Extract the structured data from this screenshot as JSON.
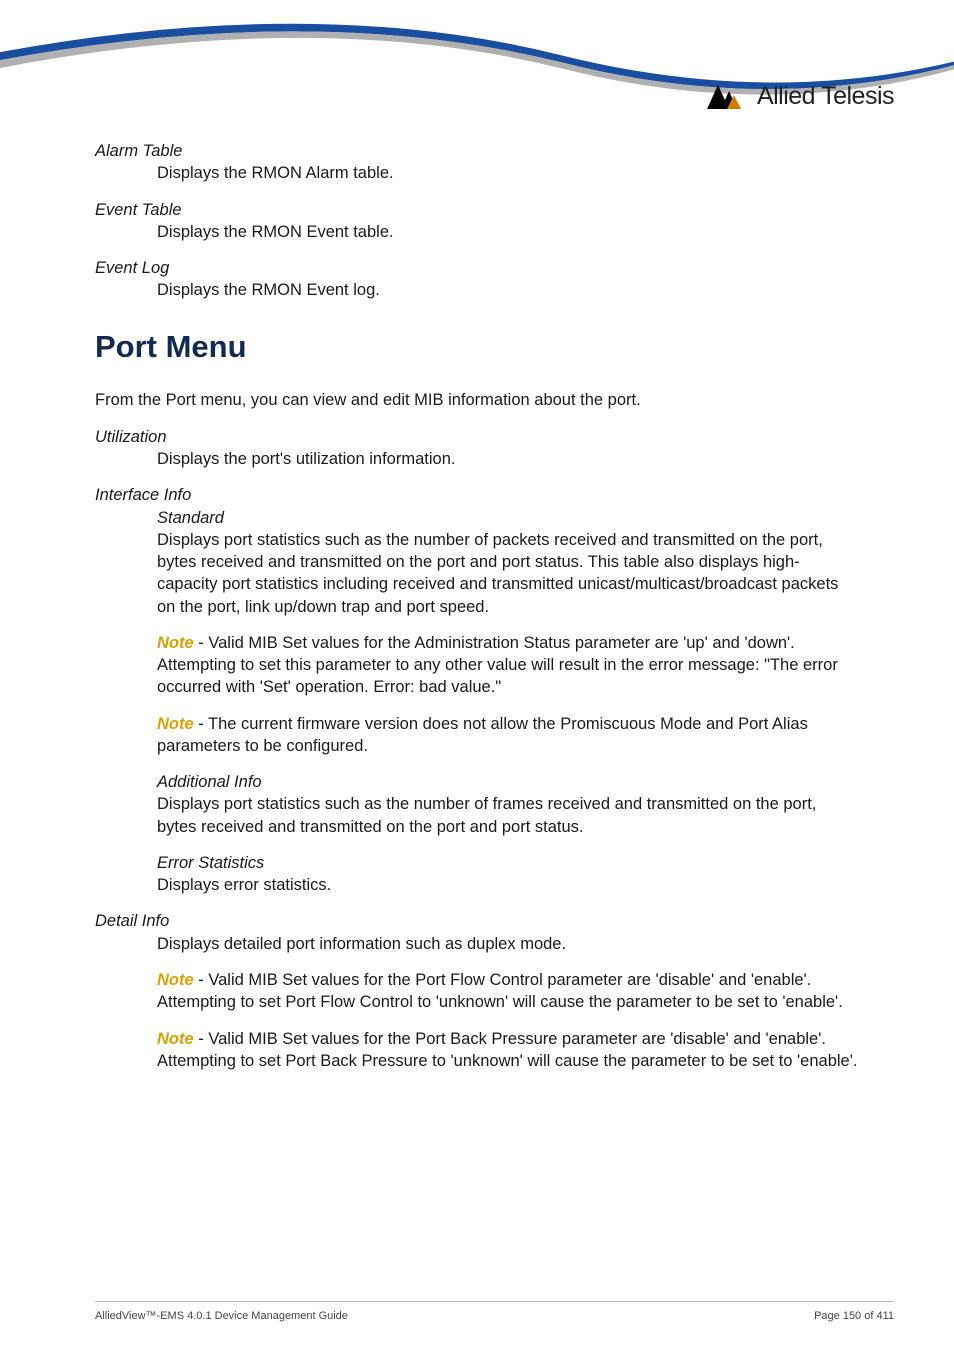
{
  "brand": "Allied Telesis",
  "sections": {
    "alarmTable": {
      "title": "Alarm Table",
      "body": "Displays the RMON Alarm table."
    },
    "eventTable": {
      "title": "Event Table",
      "body": "Displays the RMON Event table."
    },
    "eventLog": {
      "title": "Event Log",
      "body": "Displays the RMON Event log."
    }
  },
  "headingPortMenu": "Port Menu",
  "portMenuIntro": "From the Port menu, you can view and edit MIB information about the port.",
  "utilization": {
    "title": "Utilization",
    "body": "Displays the port's utilization information."
  },
  "interfaceInfo": {
    "title": "Interface Info",
    "standard": {
      "title": "Standard",
      "body": "Displays port statistics such as the number of packets received and transmitted on the port, bytes received and transmitted on the port and port status. This table also displays high-capacity port statistics including received and transmitted unicast/multicast/broadcast packets on the port, link up/down trap and port speed.",
      "note1Label": "Note",
      "note1Body": " - Valid MIB Set values for the Administration Status parameter are 'up' and 'down'. Attempting to set this parameter to any other value will result in the error message: \"The error occurred with 'Set' operation. Error: bad value.\"",
      "note2Label": "Note",
      "note2Body": " - The current firmware version does not allow the Promiscuous Mode and Port Alias parameters to be configured."
    },
    "additional": {
      "title": "Additional Info",
      "body": "Displays port statistics such as the number of frames received and transmitted on the port, bytes received and transmitted on the port and port status."
    },
    "error": {
      "title": "Error Statistics",
      "body": "Displays error statistics."
    }
  },
  "detailInfo": {
    "title": "Detail Info",
    "body": "Displays detailed port information such as duplex mode.",
    "note1Label": "Note",
    "note1Body": " - Valid MIB Set values for the Port Flow Control parameter are 'disable' and 'enable'. Attempting to set Port Flow Control to 'unknown' will cause the parameter to be set to 'enable'.",
    "note2Label": "Note",
    "note2Body": " - Valid MIB Set values for the Port Back Pressure parameter are 'disable' and 'enable'. Attempting to set Port Back Pressure to 'unknown' will cause the parameter to be set to 'enable'."
  },
  "footer": {
    "left": "AlliedView™-EMS 4.0.1 Device Management Guide",
    "right": "Page 150 of 411"
  }
}
